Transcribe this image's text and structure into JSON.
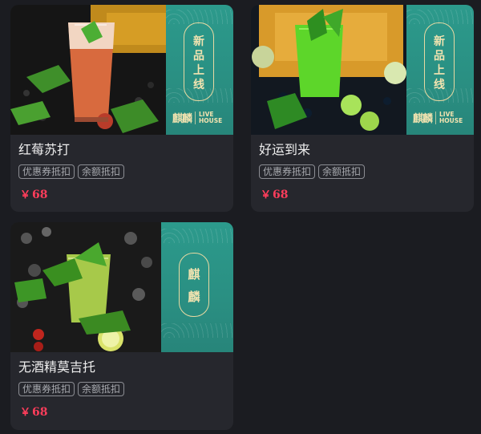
{
  "products": [
    {
      "name": "红莓苏打",
      "banner": {
        "text_lines": [
          "新",
          "品",
          "上",
          "线"
        ],
        "logo_main": "麒麟",
        "logo_sub_1": "LIVE",
        "logo_sub_2": "HOUSE"
      },
      "tags": [
        "优惠券抵扣",
        "余额抵扣"
      ],
      "currency": "￥",
      "price": "68",
      "image_icon": "red-berry-soda-icon"
    },
    {
      "name": "好运到来",
      "banner": {
        "text_lines": [
          "新",
          "品",
          "上",
          "线"
        ],
        "logo_main": "麒麟",
        "logo_sub_1": "LIVE",
        "logo_sub_2": "HOUSE"
      },
      "tags": [
        "优惠券抵扣",
        "余额抵扣"
      ],
      "currency": "￥",
      "price": "68",
      "image_icon": "green-cocktail-icon"
    },
    {
      "name": "无酒精莫吉托",
      "banner": {
        "logo_lines": [
          "麒",
          "麟"
        ]
      },
      "tags": [
        "优惠券抵扣",
        "余额抵扣"
      ],
      "currency": "￥",
      "price": "68",
      "image_icon": "mojito-icon"
    }
  ],
  "colors": {
    "background": "#1b1c21",
    "card": "#26272d",
    "banner_teal": "#2a8f82",
    "banner_gold": "#f1e3b0",
    "price_red": "#ff3d5b",
    "tag_border": "#8b8d93"
  }
}
